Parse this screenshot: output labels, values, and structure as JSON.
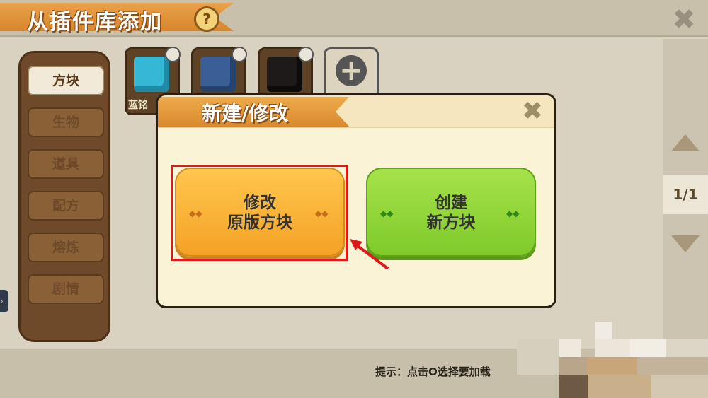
{
  "header": {
    "title": "从插件库添加",
    "help_label": "?",
    "close_label": "✖"
  },
  "sidebar": {
    "items": [
      {
        "label": "方块",
        "active": true
      },
      {
        "label": "生物",
        "active": false
      },
      {
        "label": "道具",
        "active": false
      },
      {
        "label": "配方",
        "active": false
      },
      {
        "label": "熔炼",
        "active": false
      },
      {
        "label": "剧情",
        "active": false
      }
    ]
  },
  "tiles": [
    {
      "label": "蓝铭",
      "color": "#35b8d6",
      "icon": "diamond-block-icon"
    },
    {
      "label": "",
      "color": "#3a5f96",
      "icon": "lapis-block-icon"
    },
    {
      "label": "",
      "color": "#1e1a1a",
      "icon": "obsidian-block-icon"
    }
  ],
  "add_tile": {
    "label": "+"
  },
  "pager": {
    "page": "1/1"
  },
  "hint": {
    "text": "提示：点击O选择要加载"
  },
  "dialog": {
    "title": "新建/修改",
    "close_label": "✖",
    "modify_button": {
      "line1": "修改",
      "line2": "原版方块"
    },
    "create_button": {
      "line1": "创建",
      "line2": "新方块"
    }
  },
  "colors": {
    "accent_orange": "#f4a225",
    "accent_green": "#7fca2a",
    "highlight_red": "#e01818"
  }
}
